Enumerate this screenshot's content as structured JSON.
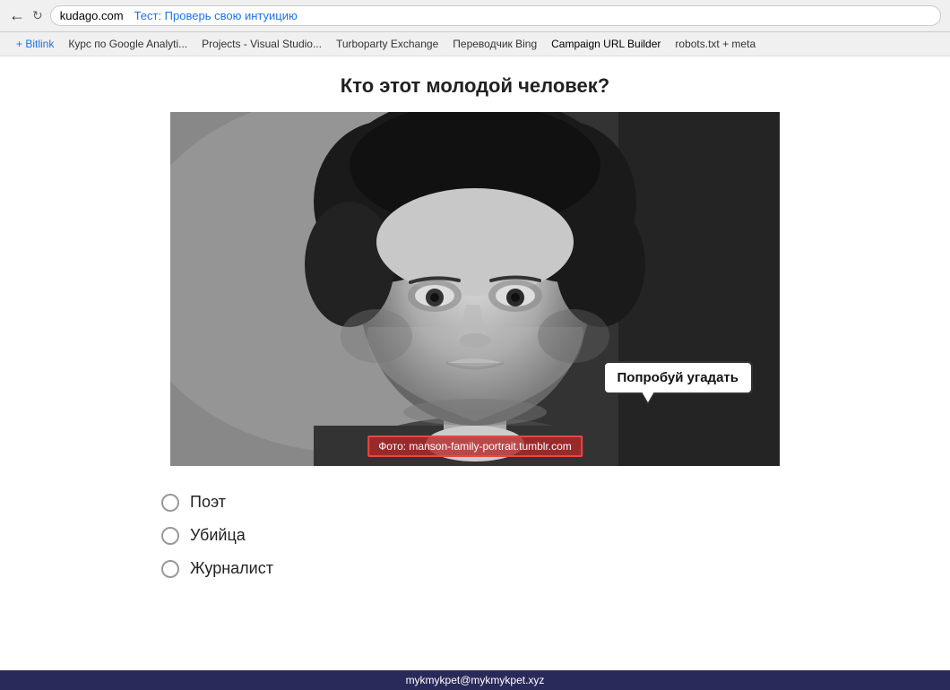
{
  "browser": {
    "back_icon": "←",
    "reload_icon": "↻",
    "address": {
      "domain": "kudago.com",
      "path": "Тест: Проверь свою интуицию",
      "path_class": "highlighted"
    },
    "bookmarks": [
      {
        "label": "+ Bitlink",
        "color": "blue"
      },
      {
        "label": "Курс по Google Analyti..."
      },
      {
        "label": "Projects - Visual Studio..."
      },
      {
        "label": "Turboparty Exchange"
      },
      {
        "label": "Переводчик Bing"
      },
      {
        "label": "Campaign URL Builder",
        "highlighted": true
      },
      {
        "label": "robots.txt + meta"
      }
    ]
  },
  "page": {
    "title": "Кто этот молодой человек?",
    "photo_credit": "Фото: manson-family-portrait.tumblr.com",
    "speech_bubble": "Попробуй угадать",
    "options": [
      {
        "label": "Поэт"
      },
      {
        "label": "Убийца"
      },
      {
        "label": "Журналист"
      }
    ]
  },
  "statusbar": {
    "email": "mykmykpet@mykmykpet.xyz"
  }
}
